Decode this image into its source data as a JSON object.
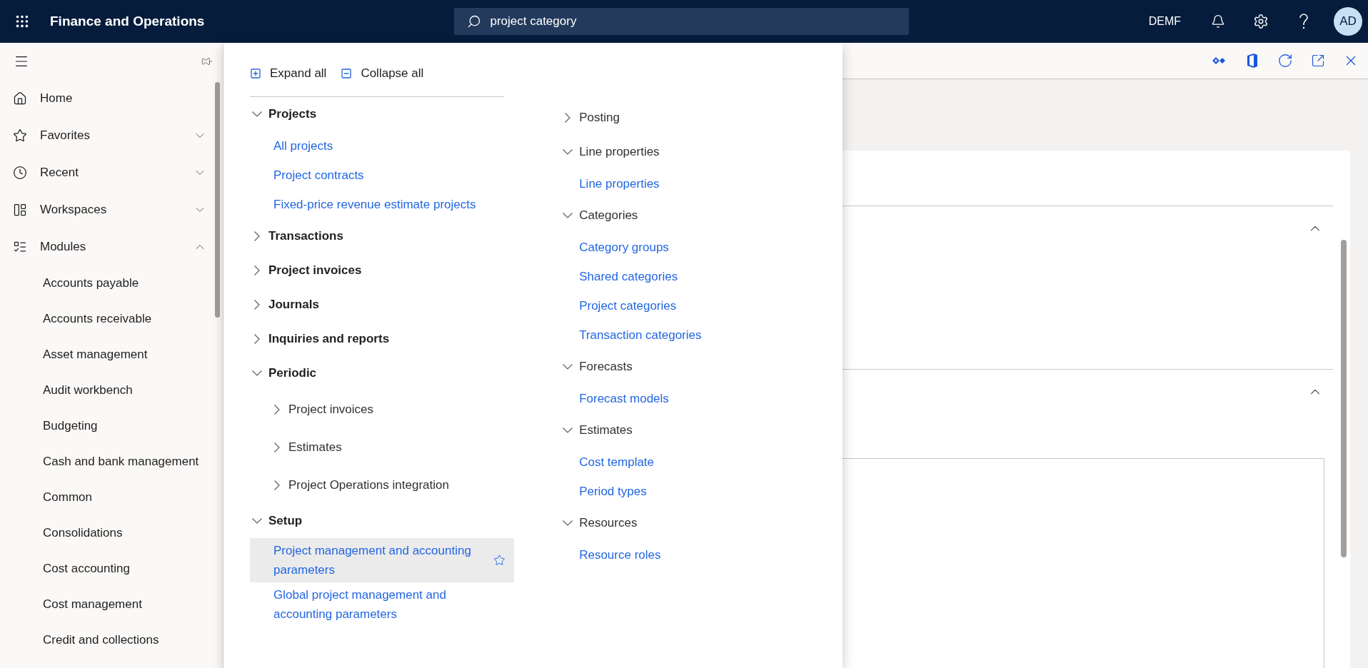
{
  "top_bar": {
    "title": "Finance and Operations",
    "search": {
      "value": "project category"
    },
    "company": "DEMF",
    "avatar": "AD"
  },
  "sidebar": {
    "items": [
      {
        "label": "Home",
        "kind": "link"
      },
      {
        "label": "Favorites",
        "kind": "group",
        "expanded": false
      },
      {
        "label": "Recent",
        "kind": "group",
        "expanded": false
      },
      {
        "label": "Workspaces",
        "kind": "group",
        "expanded": false
      },
      {
        "label": "Modules",
        "kind": "group",
        "expanded": true,
        "children": [
          "Accounts payable",
          "Accounts receivable",
          "Asset management",
          "Audit workbench",
          "Budgeting",
          "Cash and bank management",
          "Common",
          "Consolidations",
          "Cost accounting",
          "Cost management",
          "Credit and collections"
        ]
      }
    ]
  },
  "menu": {
    "actions": [
      "Expand all",
      "Collapse all"
    ],
    "columns": [
      {
        "kind": "top",
        "items": [
          {
            "kind": "group",
            "label": "Projects",
            "expanded": true,
            "children": [
              {
                "kind": "link",
                "label": "All projects",
                "selected": false
              },
              {
                "kind": "link",
                "label": "Project contracts",
                "selected": false
              },
              {
                "kind": "link",
                "label": "Fixed-price revenue estimate projects",
                "selected": false
              }
            ]
          },
          {
            "kind": "group",
            "label": "Transactions",
            "expanded": false
          },
          {
            "kind": "group",
            "label": "Project invoices",
            "expanded": false
          },
          {
            "kind": "group",
            "label": "Journals",
            "expanded": false
          },
          {
            "kind": "group",
            "label": "Inquiries and reports",
            "expanded": false
          },
          {
            "kind": "group",
            "label": "Periodic",
            "expanded": true,
            "children": [
              {
                "kind": "group",
                "label": "Project invoices",
                "expanded": false
              },
              {
                "kind": "group",
                "label": "Estimates",
                "expanded": false
              },
              {
                "kind": "group",
                "label": "Project Operations integration",
                "expanded": false
              }
            ]
          },
          {
            "kind": "group",
            "label": "Setup",
            "expanded": true,
            "children": [
              {
                "kind": "link",
                "label": "Project management and accounting parameters",
                "selected": true
              },
              {
                "kind": "link",
                "label": "Global project management and accounting parameters",
                "selected": false
              }
            ]
          }
        ]
      },
      {
        "kind": "nested",
        "items": [
          {
            "kind": "group",
            "label": "Posting",
            "expanded": false
          },
          {
            "kind": "group",
            "label": "Line properties",
            "expanded": true,
            "children": [
              {
                "kind": "link",
                "label": "Line properties",
                "selected": false
              }
            ]
          },
          {
            "kind": "group",
            "label": "Categories",
            "expanded": true,
            "children": [
              {
                "kind": "link",
                "label": "Category groups",
                "selected": false
              },
              {
                "kind": "link",
                "label": "Shared categories",
                "selected": false
              },
              {
                "kind": "link",
                "label": "Project categories",
                "selected": false
              },
              {
                "kind": "link",
                "label": "Transaction categories",
                "selected": false
              }
            ]
          },
          {
            "kind": "group",
            "label": "Forecasts",
            "expanded": true,
            "children": [
              {
                "kind": "link",
                "label": "Forecast models",
                "selected": false
              }
            ]
          },
          {
            "kind": "group",
            "label": "Estimates",
            "expanded": true,
            "children": [
              {
                "kind": "link",
                "label": "Cost template",
                "selected": false
              },
              {
                "kind": "link",
                "label": "Period types",
                "selected": false
              }
            ]
          },
          {
            "kind": "group",
            "label": "Resources",
            "expanded": true,
            "children": [
              {
                "kind": "link",
                "label": "Resource roles",
                "selected": false
              }
            ]
          }
        ]
      }
    ]
  },
  "content": {
    "sections": [
      {
        "expanded": true
      },
      {
        "expanded": true
      }
    ]
  }
}
